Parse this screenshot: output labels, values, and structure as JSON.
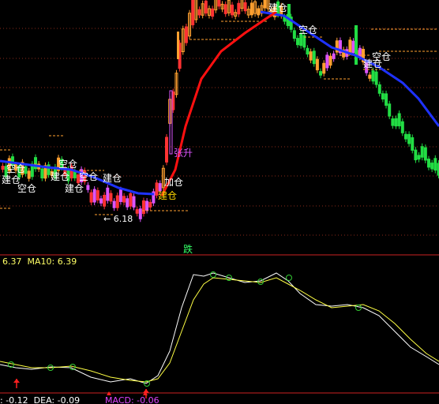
{
  "colors": {
    "background": "#000000",
    "up": "#ff3333",
    "up_hollow": "#ffa030",
    "down": "#22dd44",
    "special": "#dd55ff",
    "ma_line": "#1e32ff",
    "trend": "#ff1010",
    "grid": "#8a2a1a",
    "divider": "#cc2222",
    "label": "#ffffff",
    "build_label": "#ffd700",
    "rise_label": "#dd55ff",
    "fall_label": "#33ff66",
    "indicator_white": "#ffffff",
    "indicator_yellow": "#ffff44",
    "marker_circle": "#33cc33",
    "arrow": "#ff2020",
    "ma_text": "#ffff66",
    "macd_text": "#dd44ff"
  },
  "upper": {
    "signal_labels": [
      {
        "text": "空仓",
        "kind": "white"
      },
      {
        "text": "建仓",
        "kind": "white"
      },
      {
        "text": "空仓",
        "kind": "white"
      },
      {
        "text": "建仓",
        "kind": "white"
      },
      {
        "text": "空仓",
        "kind": "white"
      },
      {
        "text": "建仓",
        "kind": "white"
      },
      {
        "text": "空仓",
        "kind": "white"
      },
      {
        "text": "建仓",
        "kind": "white"
      },
      {
        "text": "加仓",
        "kind": "white"
      },
      {
        "text": "建仓",
        "kind": "build"
      },
      {
        "text": "建仓",
        "kind": "white"
      },
      {
        "text": "空仓",
        "kind": "white"
      },
      {
        "text": "空仓",
        "kind": "white"
      },
      {
        "text": "建仓",
        "kind": "white"
      },
      {
        "text": "张升",
        "kind": "rise"
      }
    ],
    "low_marker": "← 6.18",
    "fall_label": "跌"
  },
  "lower": {
    "ma_readout": "6.37  MA10: 6.39",
    "macd_readout": ": -0.12  DEA: -0.09",
    "macd_label": "MACD: -0.06"
  }
}
